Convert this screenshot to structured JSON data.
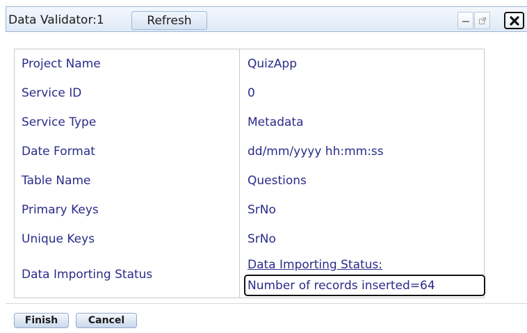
{
  "window": {
    "title": "Data Validator:1",
    "refresh_label": "Refresh",
    "minimize_icon": "minimize-icon",
    "popout_icon": "popout-icon",
    "close_icon": "close-icon"
  },
  "grid": {
    "rows": [
      {
        "label": "Project Name",
        "value": "QuizApp"
      },
      {
        "label": "Service ID",
        "value": "0"
      },
      {
        "label": "Service Type",
        "value": "Metadata"
      },
      {
        "label": "Date Format",
        "value": "dd/mm/yyyy hh:mm:ss"
      },
      {
        "label": "Table Name",
        "value": "Questions"
      },
      {
        "label": "Primary Keys",
        "value": "SrNo"
      },
      {
        "label": "Unique Keys",
        "value": "SrNo"
      }
    ],
    "status": {
      "label": "Data Importing Status",
      "line1": "Data Importing Status:",
      "line2": "Number of records inserted=64"
    }
  },
  "actions": {
    "finish_label": "Finish",
    "cancel_label": "Cancel"
  },
  "colors": {
    "text_blue": "#2b2b8a",
    "titlebar_border": "#9fb7d6"
  }
}
